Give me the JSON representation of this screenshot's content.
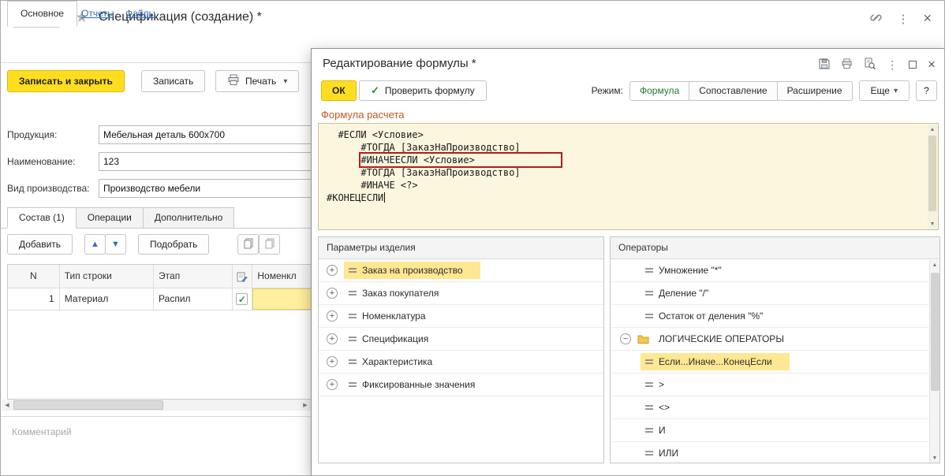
{
  "icons": {
    "back": "←",
    "forward": "→",
    "star": "★",
    "menu_dots": "⋮",
    "close": "×",
    "caret_down": "▾",
    "check": "✓",
    "arrow_up": "▲",
    "arrow_down": "▼",
    "scroll_left": "◀",
    "scroll_right": "▶",
    "scroll_up": "▲",
    "scroll_down": "▼"
  },
  "main": {
    "title": "Спецификация (создание) *",
    "nav_tabs": [
      {
        "label": "Основное",
        "active": true
      },
      {
        "label": "Отчеты"
      },
      {
        "label": "Файлы"
      }
    ],
    "command_bar": {
      "save_close": "Записать и закрыть",
      "save": "Записать",
      "print": "Печать"
    },
    "fields": [
      {
        "label": "Продукция:",
        "value": "Мебельная деталь 600х700"
      },
      {
        "label": "Наименование:",
        "value": "123"
      },
      {
        "label": "Вид производства:",
        "value": "Производство мебели"
      }
    ],
    "content_tabs": [
      {
        "label": "Состав (1)",
        "active": true
      },
      {
        "label": "Операции"
      },
      {
        "label": "Дополнительно"
      }
    ],
    "table_toolbar": {
      "add": "Добавить",
      "pick": "Подобрать"
    },
    "table": {
      "columns": [
        "N",
        "Тип строки",
        "Этап",
        "Номенкл"
      ],
      "row": {
        "n": "1",
        "type": "Материал",
        "stage": "Распил",
        "checked": "✓"
      }
    },
    "comment_placeholder": "Комментарий"
  },
  "dialog": {
    "title": "Редактирование формулы *",
    "ok": "ОК",
    "check_formula": "Проверить формулу",
    "mode_label": "Режим:",
    "modes": [
      {
        "label": "Формула",
        "active": true
      },
      {
        "label": "Сопоставление"
      },
      {
        "label": "Расширение"
      }
    ],
    "more": "Еще",
    "help": "?",
    "formula_section": "Формула расчета",
    "formula_lines": [
      {
        "spaces": "  ",
        "text": "#ЕСЛИ <Условие>"
      },
      {
        "spaces": "      ",
        "text": "#ТОГДА [ЗаказНаПроизводство]"
      },
      {
        "spaces": "      ",
        "text": "#ИНАЧЕЕСЛИ <Условие>",
        "error": true
      },
      {
        "spaces": "      ",
        "text": "#ТОГДА [ЗаказНаПроизводство]"
      },
      {
        "spaces": "      ",
        "text": "#ИНАЧЕ <?>"
      },
      {
        "spaces": "",
        "text": "#КОНЕЦЕСЛИ",
        "cursor": true
      }
    ],
    "params_panel": {
      "title": "Параметры изделия",
      "items": [
        {
          "label": "Заказ на производство",
          "selected": true
        },
        {
          "label": "Заказ покупателя"
        },
        {
          "label": "Номенклатура"
        },
        {
          "label": "Спецификация"
        },
        {
          "label": "Характеристика"
        },
        {
          "label": "Фиксированные значения"
        }
      ]
    },
    "operators_panel": {
      "title": "Операторы",
      "items": [
        {
          "label": "Умножение \"*\""
        },
        {
          "label": "Деление \"/\""
        },
        {
          "label": "Остаток от деления \"%\""
        },
        {
          "label": "ЛОГИЧЕСКИЕ ОПЕРАТОРЫ",
          "folder": true
        },
        {
          "label": "Если...Иначе...КонецЕсли",
          "selected": true
        },
        {
          "label": ">"
        },
        {
          "label": "<>"
        },
        {
          "label": "И"
        },
        {
          "label": "ИЛИ"
        }
      ]
    }
  }
}
